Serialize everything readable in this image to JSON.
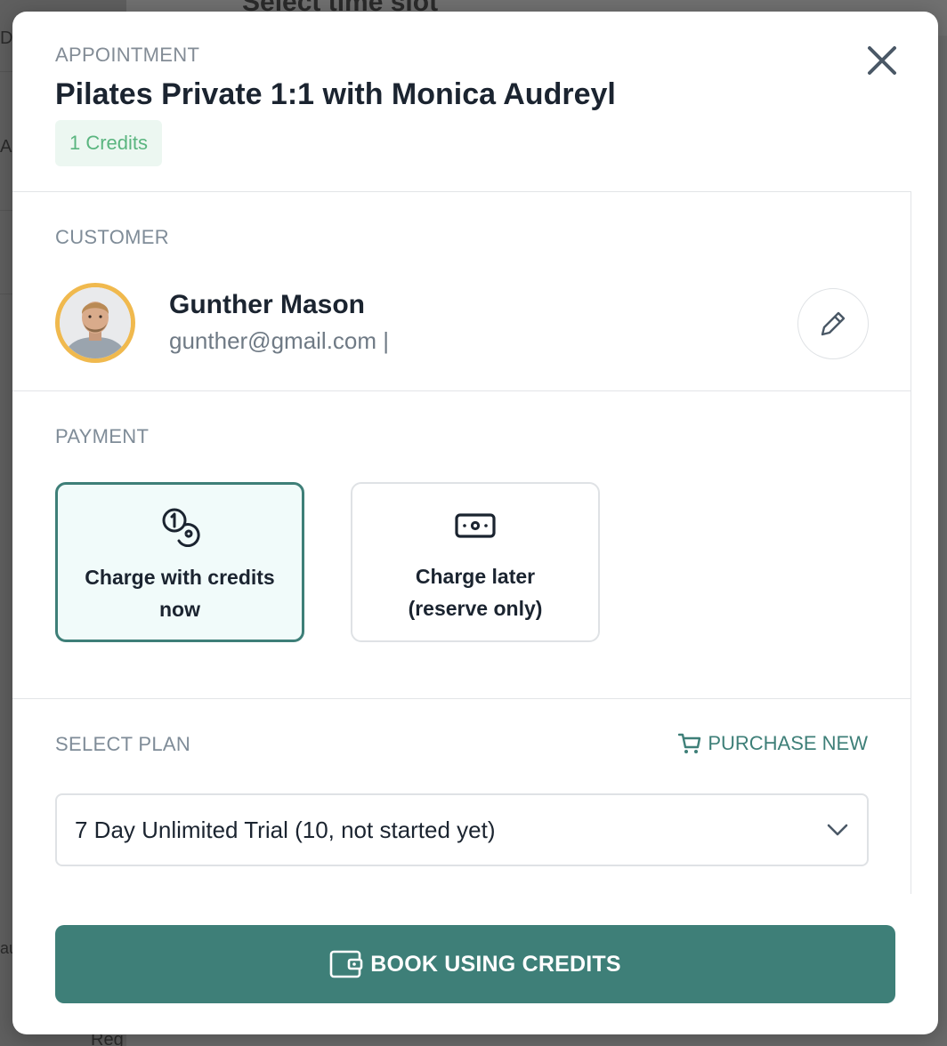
{
  "background": {
    "title_fragment": "Select time slot",
    "fragment_1": "DA",
    "fragment_2": "Ap",
    "fragment_3": "au",
    "fragment_4": "Reg"
  },
  "modal": {
    "eyebrow": "APPOINTMENT",
    "title": "Pilates Private 1:1 with Monica Audreyl",
    "credits_badge": "1 Credits",
    "close_icon": "close-icon"
  },
  "customer": {
    "section_label": "CUSTOMER",
    "name": "Gunther Mason",
    "email": "gunther@gmail.com |",
    "avatar_icon": "avatar",
    "edit_icon": "pencil-icon"
  },
  "payment": {
    "section_label": "PAYMENT",
    "options": [
      {
        "label_line1": "Charge with credits",
        "label_line2": "now",
        "icon": "coins-icon",
        "selected": true
      },
      {
        "label_line1": "Charge later",
        "label_line2": "(reserve only)",
        "icon": "banknote-icon",
        "selected": false
      }
    ]
  },
  "plan": {
    "section_label": "SELECT PLAN",
    "purchase_label": "PURCHASE NEW",
    "purchase_icon": "cart-icon",
    "selected_value": "7 Day Unlimited Trial (10, not started yet)",
    "dropdown_icon": "chevron-down-icon"
  },
  "footer": {
    "book_label": "BOOK USING CREDITS",
    "book_icon": "wallet-icon"
  },
  "colors": {
    "accent": "#3e7f78",
    "accent_light": "#f1fbfa",
    "badge_bg": "#ecf7f1",
    "badge_text": "#5ab57f",
    "avatar_ring": "#f0b94e",
    "title_text": "#1b2430",
    "muted_text": "#7f8c98"
  }
}
